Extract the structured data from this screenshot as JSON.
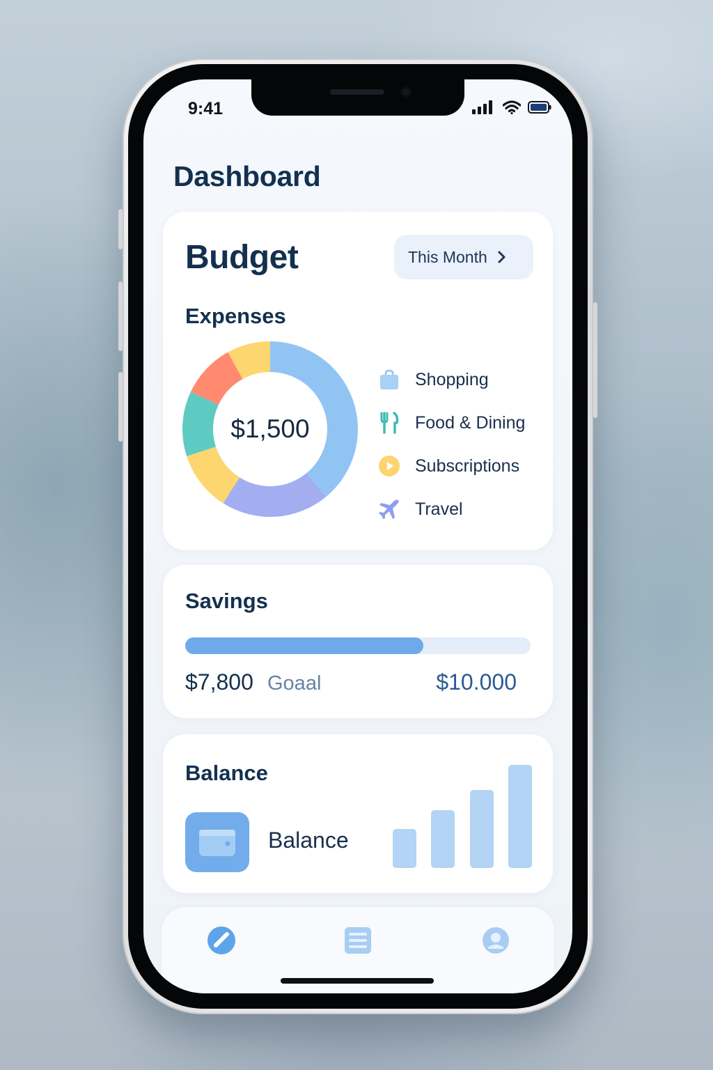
{
  "status_bar": {
    "time": "9:41"
  },
  "page": {
    "title": "Dashboard"
  },
  "budget": {
    "title": "Budget",
    "period_button": "This Month",
    "expenses_label": "Expenses",
    "total": "$1,500",
    "legend": [
      {
        "label": "Shopping",
        "icon": "shopping-bag-icon",
        "color": "#8ec2f2"
      },
      {
        "label": "Food & Dining",
        "icon": "fork-knife-icon",
        "color": "#4fc7bd"
      },
      {
        "label": "Subscriptions",
        "icon": "play-icon",
        "color": "#f8cf62"
      },
      {
        "label": "Travel",
        "icon": "airplane-icon",
        "color": "#8c9ef0"
      }
    ]
  },
  "chart_data": {
    "type": "pie",
    "segments": [
      {
        "value": 39,
        "color": "#91c4f3"
      },
      {
        "value": 20,
        "color": "#a2aef0"
      },
      {
        "value": 11,
        "color": "#fdd670"
      },
      {
        "value": 12,
        "color": "#5ecbc3"
      },
      {
        "value": 10,
        "color": "#ff8a70"
      },
      {
        "value": 8,
        "color": "#fdd670"
      }
    ]
  },
  "savings": {
    "title": "Savings",
    "amount": "$7,800",
    "goal_label": "Goaal",
    "goal_amount": "$10.000",
    "progress": 0.69,
    "color": "#6eaaea"
  },
  "balance": {
    "title": "Balance",
    "label": "Balance",
    "bars": [
      0.38,
      0.56,
      0.76,
      1.0
    ],
    "bar_color": "#b3d4f4"
  },
  "tabbar": {
    "tabs": [
      {
        "icon": "pie-chart-icon",
        "active": true
      },
      {
        "icon": "list-icon",
        "active": false
      },
      {
        "icon": "profile-icon",
        "active": false
      }
    ]
  },
  "colors": {
    "accent": "#6eaaea",
    "title": "#14304f"
  }
}
